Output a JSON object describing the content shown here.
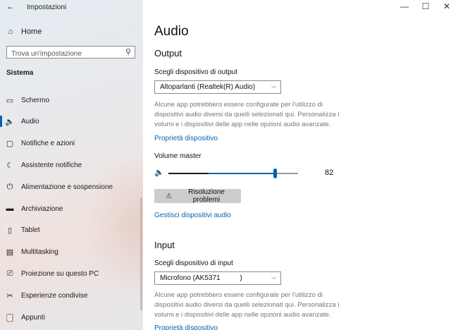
{
  "window": {
    "title": "Impostazioni",
    "controls": {
      "minimize": "—",
      "maximize": "☐",
      "close": "✕"
    }
  },
  "sidebar": {
    "home": {
      "icon": "home-icon",
      "label": "Home"
    },
    "search": {
      "placeholder": "Trova un'impostazione",
      "icon": "search-icon"
    },
    "section": "Sistema",
    "items": [
      {
        "icon": "monitor-icon",
        "label": "Schermo"
      },
      {
        "icon": "speaker-icon",
        "label": "Audio",
        "active": true
      },
      {
        "icon": "notification-icon",
        "label": "Notifiche e azioni"
      },
      {
        "icon": "moon-icon",
        "label": "Assistente notifiche"
      },
      {
        "icon": "power-icon",
        "label": "Alimentazione e sospensione"
      },
      {
        "icon": "storage-icon",
        "label": "Archiviazione"
      },
      {
        "icon": "tablet-icon",
        "label": "Tablet"
      },
      {
        "icon": "multitasking-icon",
        "label": "Multitasking"
      },
      {
        "icon": "project-icon",
        "label": "Proiezione su questo PC"
      },
      {
        "icon": "share-icon",
        "label": "Esperienze condivise"
      },
      {
        "icon": "clipboard-icon",
        "label": "Appunti"
      }
    ]
  },
  "main": {
    "title": "Audio",
    "output": {
      "heading": "Output",
      "device_label": "Scegli dispositivo di output",
      "device_value": "Altoparlanti (Realtek(R) Audio)",
      "description": "Alcune app potrebbero essere configurate per l'utilizzo di dispositivi audio diversi da quelli selezionati qui. Personalizza i volumi e i dispositivi delle app nelle opzioni audio avanzate.",
      "properties_link": "Proprietà dispositivo",
      "volume_label": "Volume master",
      "volume_value": "82",
      "volume": 82,
      "level": 0.31,
      "troubleshoot_button": "Risoluzione problemi",
      "manage_link": "Gestisci dispositivi audio"
    },
    "input": {
      "heading": "Input",
      "device_label": "Scegli dispositivo di input",
      "device_value": "Microfono (AK5371          )",
      "description": "Alcune app potrebbero essere configurate per l'utilizzo di dispositivi audio diversi da quelli selezionati qui. Personalizza i volumi e i dispositivi delle app nelle opzioni audio avanzate.",
      "properties_link": "Proprietà dispositivo"
    }
  }
}
